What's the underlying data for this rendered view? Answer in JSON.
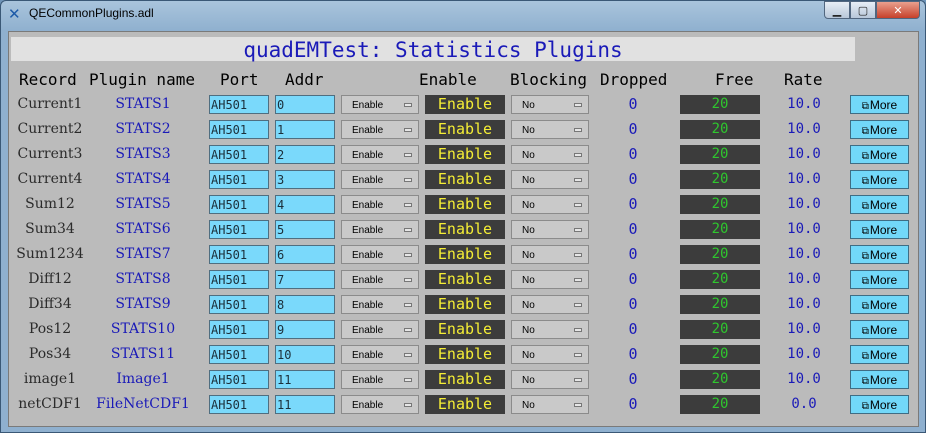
{
  "window": {
    "title": "QECommonPlugins.adl"
  },
  "heading": "quadEMTest: Statistics Plugins",
  "headers": {
    "record": "Record",
    "plugin": "Plugin name",
    "port": "Port",
    "addr": "Addr",
    "enable": "Enable",
    "blocking": "Blocking",
    "dropped": "Dropped",
    "free": "Free",
    "rate": "Rate"
  },
  "rows": [
    {
      "record": "Current1",
      "plugin": "STATS1",
      "port": "AH501",
      "addr": "0",
      "enable_sel": "Enable",
      "enable_stat": "Enable",
      "blocking": "No",
      "dropped": "0",
      "free": "20",
      "rate": "10.0",
      "more": "More"
    },
    {
      "record": "Current2",
      "plugin": "STATS2",
      "port": "AH501",
      "addr": "1",
      "enable_sel": "Enable",
      "enable_stat": "Enable",
      "blocking": "No",
      "dropped": "0",
      "free": "20",
      "rate": "10.0",
      "more": "More"
    },
    {
      "record": "Current3",
      "plugin": "STATS3",
      "port": "AH501",
      "addr": "2",
      "enable_sel": "Enable",
      "enable_stat": "Enable",
      "blocking": "No",
      "dropped": "0",
      "free": "20",
      "rate": "10.0",
      "more": "More"
    },
    {
      "record": "Current4",
      "plugin": "STATS4",
      "port": "AH501",
      "addr": "3",
      "enable_sel": "Enable",
      "enable_stat": "Enable",
      "blocking": "No",
      "dropped": "0",
      "free": "20",
      "rate": "10.0",
      "more": "More"
    },
    {
      "record": "Sum12",
      "plugin": "STATS5",
      "port": "AH501",
      "addr": "4",
      "enable_sel": "Enable",
      "enable_stat": "Enable",
      "blocking": "No",
      "dropped": "0",
      "free": "20",
      "rate": "10.0",
      "more": "More"
    },
    {
      "record": "Sum34",
      "plugin": "STATS6",
      "port": "AH501",
      "addr": "5",
      "enable_sel": "Enable",
      "enable_stat": "Enable",
      "blocking": "No",
      "dropped": "0",
      "free": "20",
      "rate": "10.0",
      "more": "More"
    },
    {
      "record": "Sum1234",
      "plugin": "STATS7",
      "port": "AH501",
      "addr": "6",
      "enable_sel": "Enable",
      "enable_stat": "Enable",
      "blocking": "No",
      "dropped": "0",
      "free": "20",
      "rate": "10.0",
      "more": "More"
    },
    {
      "record": "Diff12",
      "plugin": "STATS8",
      "port": "AH501",
      "addr": "7",
      "enable_sel": "Enable",
      "enable_stat": "Enable",
      "blocking": "No",
      "dropped": "0",
      "free": "20",
      "rate": "10.0",
      "more": "More"
    },
    {
      "record": "Diff34",
      "plugin": "STATS9",
      "port": "AH501",
      "addr": "8",
      "enable_sel": "Enable",
      "enable_stat": "Enable",
      "blocking": "No",
      "dropped": "0",
      "free": "20",
      "rate": "10.0",
      "more": "More"
    },
    {
      "record": "Pos12",
      "plugin": "STATS10",
      "port": "AH501",
      "addr": "9",
      "enable_sel": "Enable",
      "enable_stat": "Enable",
      "blocking": "No",
      "dropped": "0",
      "free": "20",
      "rate": "10.0",
      "more": "More"
    },
    {
      "record": "Pos34",
      "plugin": "STATS11",
      "port": "AH501",
      "addr": "10",
      "enable_sel": "Enable",
      "enable_stat": "Enable",
      "blocking": "No",
      "dropped": "0",
      "free": "20",
      "rate": "10.0",
      "more": "More"
    },
    {
      "record": "image1",
      "plugin": "Image1",
      "port": "AH501",
      "addr": "11",
      "enable_sel": "Enable",
      "enable_stat": "Enable",
      "blocking": "No",
      "dropped": "0",
      "free": "20",
      "rate": "10.0",
      "more": "More"
    },
    {
      "record": "netCDF1",
      "plugin": "FileNetCDF1",
      "port": "AH501",
      "addr": "11",
      "enable_sel": "Enable",
      "enable_stat": "Enable",
      "blocking": "No",
      "dropped": "0",
      "free": "20",
      "rate": "0.0",
      "more": "More"
    }
  ]
}
